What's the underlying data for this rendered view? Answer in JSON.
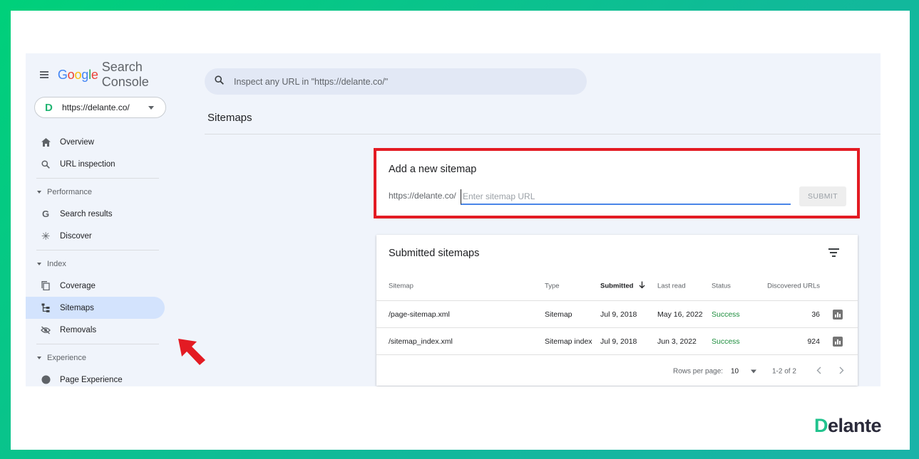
{
  "brand": {
    "google": [
      "G",
      "o",
      "o",
      "g",
      "l",
      "e"
    ],
    "product": "Search Console"
  },
  "colors": {
    "google_letters": [
      "#4285f4",
      "#ea4335",
      "#fbbc05",
      "#4285f4",
      "#34a853",
      "#ea4335"
    ],
    "accent": "#1a73e8",
    "highlight": "#e31b23",
    "success": "#1e8e3e"
  },
  "search": {
    "placeholder": "Inspect any URL in \"https://delante.co/\""
  },
  "property": {
    "logo": "D",
    "url": "https://delante.co/"
  },
  "nav": {
    "overview": "Overview",
    "url_inspection": "URL inspection",
    "performance": "Performance",
    "search_results": "Search results",
    "discover": "Discover",
    "index": "Index",
    "coverage": "Coverage",
    "sitemaps": "Sitemaps",
    "removals": "Removals",
    "experience": "Experience",
    "page_experience": "Page Experience"
  },
  "page": {
    "title": "Sitemaps"
  },
  "add_sitemap": {
    "title": "Add a new sitemap",
    "prefix": "https://delante.co/",
    "placeholder": "Enter sitemap URL",
    "submit": "SUBMIT"
  },
  "submitted": {
    "title": "Submitted sitemaps",
    "columns": {
      "sitemap": "Sitemap",
      "type": "Type",
      "submitted": "Submitted",
      "last_read": "Last read",
      "status": "Status",
      "urls": "Discovered URLs"
    },
    "rows": [
      {
        "sitemap": "/page-sitemap.xml",
        "type": "Sitemap",
        "submitted": "Jul 9, 2018",
        "last_read": "May 16, 2022",
        "status": "Success",
        "urls": "36"
      },
      {
        "sitemap": "/sitemap_index.xml",
        "type": "Sitemap index",
        "submitted": "Jul 9, 2018",
        "last_read": "Jun 3, 2022",
        "status": "Success",
        "urls": "924"
      }
    ],
    "pager": {
      "rows_label": "Rows per page:",
      "rows_value": "10",
      "range": "1-2 of 2"
    }
  },
  "watermark": {
    "d": "D",
    "rest": "elante"
  }
}
